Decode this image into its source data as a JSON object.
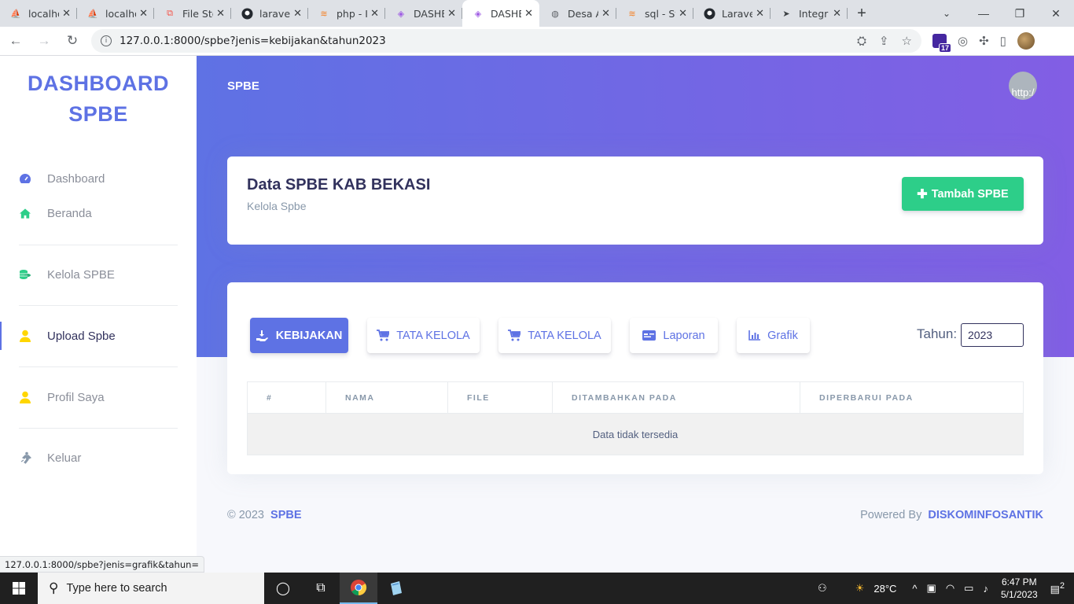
{
  "browser": {
    "tabs": [
      {
        "title": "localho",
        "icon": "pma-icon"
      },
      {
        "title": "localho",
        "icon": "pma-icon"
      },
      {
        "title": "File Sto",
        "icon": "laravel-icon"
      },
      {
        "title": "laravel",
        "icon": "github-icon"
      },
      {
        "title": "php - I",
        "icon": "stackoverflow-icon"
      },
      {
        "title": "DASHB",
        "icon": "vue-icon"
      },
      {
        "title": "DASHB",
        "icon": "vue-icon",
        "active": true
      },
      {
        "title": "Desa A",
        "icon": "globe-icon"
      },
      {
        "title": "sql - St",
        "icon": "stackoverflow-icon"
      },
      {
        "title": "Larave",
        "icon": "github-icon"
      },
      {
        "title": "Integr",
        "icon": "send-icon"
      }
    ],
    "url": "127.0.0.1:8000/spbe?jenis=kebijakan&tahun2023",
    "extension_badge": "17",
    "status_url": "127.0.0.1:8000/spbe?jenis=grafik&tahun="
  },
  "sidebar": {
    "brand_line1": "DASHBOARD",
    "brand_line2": "SPBE",
    "items": [
      {
        "label": "Dashboard",
        "icon": "gauge-icon",
        "color": "#5e72e4"
      },
      {
        "label": "Beranda",
        "icon": "home-icon",
        "color": "#2dce89"
      },
      {
        "label": "Kelola SPBE",
        "icon": "coins-icon",
        "color": "#2dce89"
      },
      {
        "label": "Upload Spbe",
        "icon": "user-icon",
        "color": "#ffd600"
      },
      {
        "label": "Profil Saya",
        "icon": "user-icon",
        "color": "#ffd600"
      },
      {
        "label": "Keluar",
        "icon": "running-icon",
        "color": "#8898aa"
      }
    ]
  },
  "header": {
    "title": "SPBE",
    "avatar_alt": "http:/"
  },
  "card": {
    "title": "Data SPBE KAB BEKASI",
    "subtitle": "Kelola Spbe",
    "add_button": "Tambah SPBE"
  },
  "tabs": [
    {
      "label": "KEBIJAKAN",
      "icon": "hand-icon",
      "active": true
    },
    {
      "label": "TATA KELOLA",
      "icon": "cart-icon"
    },
    {
      "label": "TATA KELOLA",
      "icon": "cart-icon"
    },
    {
      "label": "Laporan",
      "icon": "id-card-icon"
    },
    {
      "label": "Grafik",
      "icon": "bar-chart-icon"
    }
  ],
  "filter": {
    "label": "Tahun:",
    "value": "2023"
  },
  "table": {
    "columns": [
      "#",
      "NAMA",
      "FILE",
      "DITAMBAHKAN PADA",
      "DIPERBARUI PADA"
    ],
    "empty_message": "Data tidak tersedia"
  },
  "footer": {
    "copyright": "© 2023",
    "brand": "SPBE",
    "powered_by": "Powered By",
    "company": "DISKOMINFOSANTIK"
  },
  "taskbar": {
    "search_placeholder": "Type here to search",
    "temperature": "28°C",
    "time": "6:47 PM",
    "date": "5/1/2023",
    "notifications": "2"
  },
  "colors": {
    "primary": "#5e72e4",
    "success": "#2dce89",
    "warning": "#ffd600"
  }
}
